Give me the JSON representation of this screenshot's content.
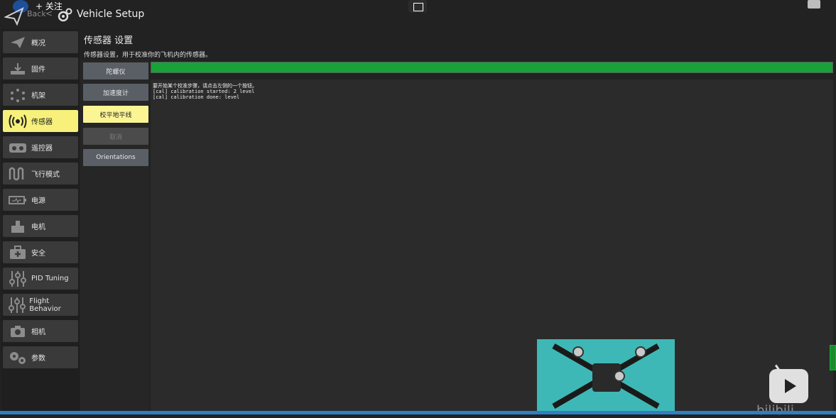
{
  "overlay": {
    "follow_text": "+ 关注",
    "watermark_text": "bilibili"
  },
  "header": {
    "back_label": "Back",
    "back_chevron": "<",
    "title": "Vehicle Setup"
  },
  "page": {
    "title": "传感器 设置",
    "subtitle": "传感器设置，用于校准你的飞机内的传感器。"
  },
  "sidebar": {
    "items": [
      {
        "label": "概况",
        "icon": "paper-plane-icon"
      },
      {
        "label": "固件",
        "icon": "download-icon"
      },
      {
        "label": "机架",
        "icon": "airframe-icon"
      },
      {
        "label": "传感器",
        "icon": "radio-waves-icon",
        "active": true
      },
      {
        "label": "遥控器",
        "icon": "remote-control-icon"
      },
      {
        "label": "飞行模式",
        "icon": "wave-icon"
      },
      {
        "label": "电源",
        "icon": "battery-icon"
      },
      {
        "label": "电机",
        "icon": "motor-icon"
      },
      {
        "label": "安全",
        "icon": "medkit-icon"
      },
      {
        "label": "PID Tuning",
        "icon": "sliders-icon"
      },
      {
        "label": "Flight Behavior",
        "icon": "sliders-icon"
      },
      {
        "label": "相机",
        "icon": "camera-icon"
      },
      {
        "label": "参数",
        "icon": "gears-icon"
      }
    ]
  },
  "buttons": {
    "gyro": "陀螺仪",
    "accel": "加速度计",
    "level_horizon": "校平地平线",
    "cancel": "取消",
    "orientations": "Orientations"
  },
  "progress": {
    "value": 1.0,
    "color": "#19a23a"
  },
  "log": {
    "lines": [
      "要开始某个校准步骤，请点击左侧的一个按钮。",
      "[cal] calibration started: 2 level",
      "[cal] calibration done: level"
    ]
  },
  "colors": {
    "accent_yellow": "#f7f07b",
    "progress_green": "#19a23a",
    "background": "#222222"
  }
}
